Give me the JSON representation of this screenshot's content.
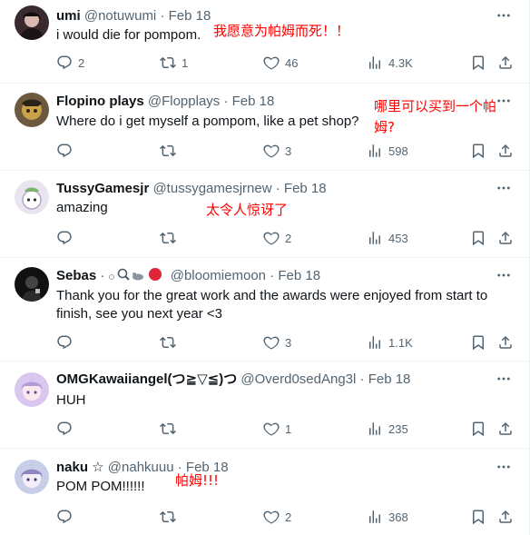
{
  "tweets": [
    {
      "name": "umi",
      "handle": "@notuwumi",
      "date": "Feb 18",
      "text": "i would die for pompom.",
      "annotation": "我愿意为帕姆而死！！",
      "replies": "2",
      "reposts": "1",
      "likes": "46",
      "views": "4.3K"
    },
    {
      "name": "Flopino plays",
      "handle": "@Flopplays",
      "date": "Feb 18",
      "text": "Where do i get myself a pompom, like a pet shop?",
      "annotation_line1": "哪里可以买到一个帕",
      "annotation_line2": "姆?",
      "replies": "",
      "reposts": "",
      "likes": "3",
      "views": "598"
    },
    {
      "name": "TussyGamesjr",
      "handle": "@tussygamesjrnew",
      "date": "Feb 18",
      "text": "amazing",
      "annotation": "太令人惊讶了",
      "replies": "",
      "reposts": "",
      "likes": "2",
      "views": "453"
    },
    {
      "name": "Sebas",
      "handle": "@bloomiemoon",
      "date": "Feb 18",
      "text_line1": "Thank you for the great work and the awards were enjoyed from start to",
      "text_line2": "finish, see you next year <3",
      "replies": "",
      "reposts": "",
      "likes": "3",
      "views": "1.1K"
    },
    {
      "name": "OMGKawaiiangel(つ≧▽≦)つ",
      "handle": "@Overd0sedAng3l",
      "date": "Feb 18",
      "text": "HUH",
      "replies": "",
      "reposts": "",
      "likes": "1",
      "views": "235"
    },
    {
      "name": "naku ☆",
      "handle": "@nahkuuu",
      "date": "Feb 18",
      "text": "POM POM!!!!!!",
      "annotation": "帕姆!!!",
      "replies": "",
      "reposts": "",
      "likes": "2",
      "views": "368"
    }
  ],
  "dot": "·",
  "icons": {
    "reply": "reply-icon",
    "repost": "repost-icon",
    "like": "heart-icon",
    "views": "views-icon",
    "bookmark": "bookmark-icon",
    "share": "share-icon",
    "more": "more-icon"
  },
  "colors": {
    "annotation": "#ff0000",
    "secondary_text": "#536471",
    "divider": "#eff3f4"
  }
}
